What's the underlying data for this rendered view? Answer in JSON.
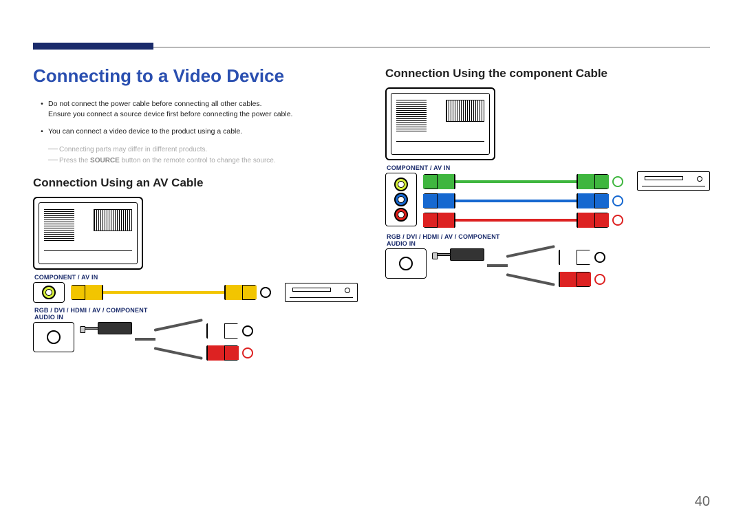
{
  "page_number": "40",
  "heading_main": "Connecting to a Video Device",
  "bullets": [
    "Do not connect the power cable before connecting all other cables.\nEnsure you connect a source device first before connecting the power cable.",
    "You can connect a video device to the product using a cable."
  ],
  "notes": {
    "line1": "Connecting parts may differ in different products.",
    "line2_pre": "Press the ",
    "line2_bold": "SOURCE",
    "line2_post": " button on the remote control to change the source."
  },
  "sub_heading_left": "Connection Using an AV Cable",
  "sub_heading_right": "Connection Using the component Cable",
  "labels": {
    "component_av_in": "COMPONENT / AV IN",
    "audio_in": "RGB / DVI / HDMI / AV / COMPONENT\nAUDIO IN"
  }
}
